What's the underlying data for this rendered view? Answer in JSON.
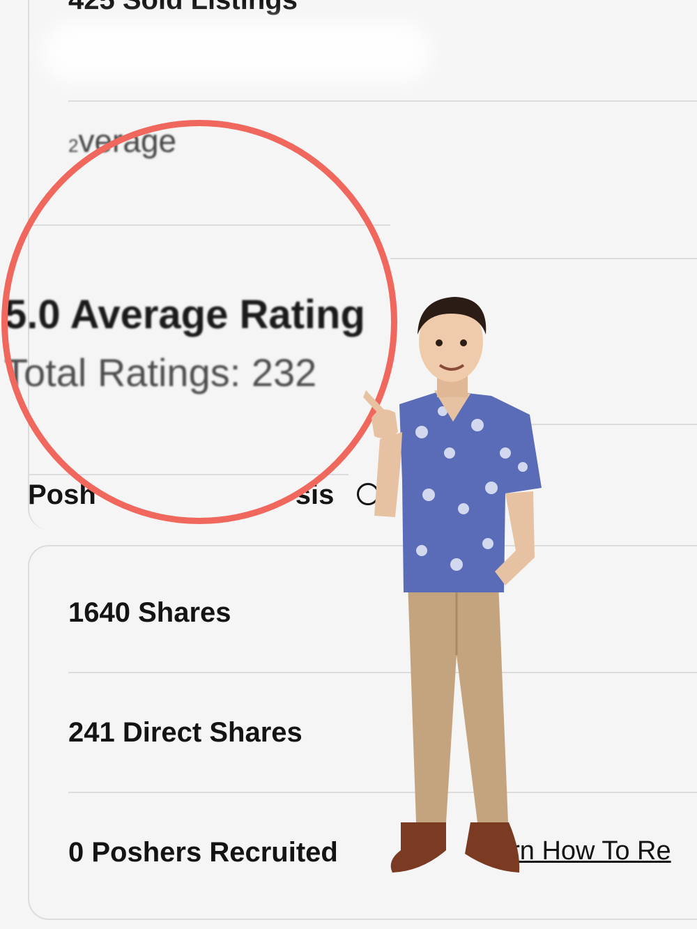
{
  "stats_top": {
    "sold_listings": "425 Sold Listings",
    "average_fragment": "verage",
    "average_prefix": "2"
  },
  "zoom": {
    "average_rating": "5.0 Average Rating",
    "total_ratings": "Total Ratings: 232"
  },
  "section": {
    "title_fragment": "Posh",
    "title_fragment_end": "sis"
  },
  "stats_bottom": {
    "shares": "1640 Shares",
    "direct_shares": "241 Direct Shares",
    "poshers_recruited": "0 Poshers Recruited",
    "learn_link": "arn How To Re"
  },
  "colors": {
    "highlight_circle": "#f0685d",
    "background": "#f6f5f5",
    "divider": "#dcdcdc"
  },
  "icons": {
    "info": "info-icon"
  }
}
